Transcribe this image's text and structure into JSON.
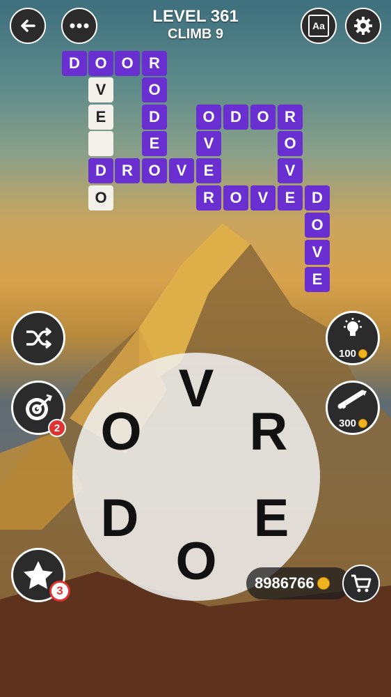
{
  "header": {
    "level_label": "LEVEL 361",
    "sub_label": "CLIMB 9"
  },
  "buttons": {
    "back_icon": "arrow-left",
    "menu_icon": "ellipsis",
    "dictionary_label": "Aa",
    "settings_icon": "gear"
  },
  "grid_letters": {
    "t1": "D",
    "t2": "O",
    "t3": "O",
    "t4": "R",
    "t5": "V",
    "t6": "O",
    "t7": "E",
    "t8": "D",
    "t9": "",
    "t10": "E",
    "t11": "D",
    "t12": "R",
    "t13": "O",
    "t14": "V",
    "t15": "E",
    "t16": "O",
    "t17": "O",
    "t18": "D",
    "t19": "O",
    "t20": "R",
    "t21": "V",
    "t22": "O",
    "t23": "E",
    "t24": "V",
    "t25": "R",
    "t26": "O",
    "t27": "V",
    "t28": "E",
    "t29": "D",
    "t30": "O",
    "t31": "V",
    "t32": "E"
  },
  "boosters": {
    "hint_cost": "100",
    "rocket_cost": "300",
    "target_badge": "2",
    "star_badge": "3"
  },
  "wheel_letters": [
    "V",
    "O",
    "R",
    "D",
    "E",
    "O"
  ],
  "coins": "8986766",
  "colors": {
    "tile": "#6a2fd0",
    "hint_tile": "#f2f0e8",
    "badge": "#e03232",
    "coin": "#f2b320"
  }
}
